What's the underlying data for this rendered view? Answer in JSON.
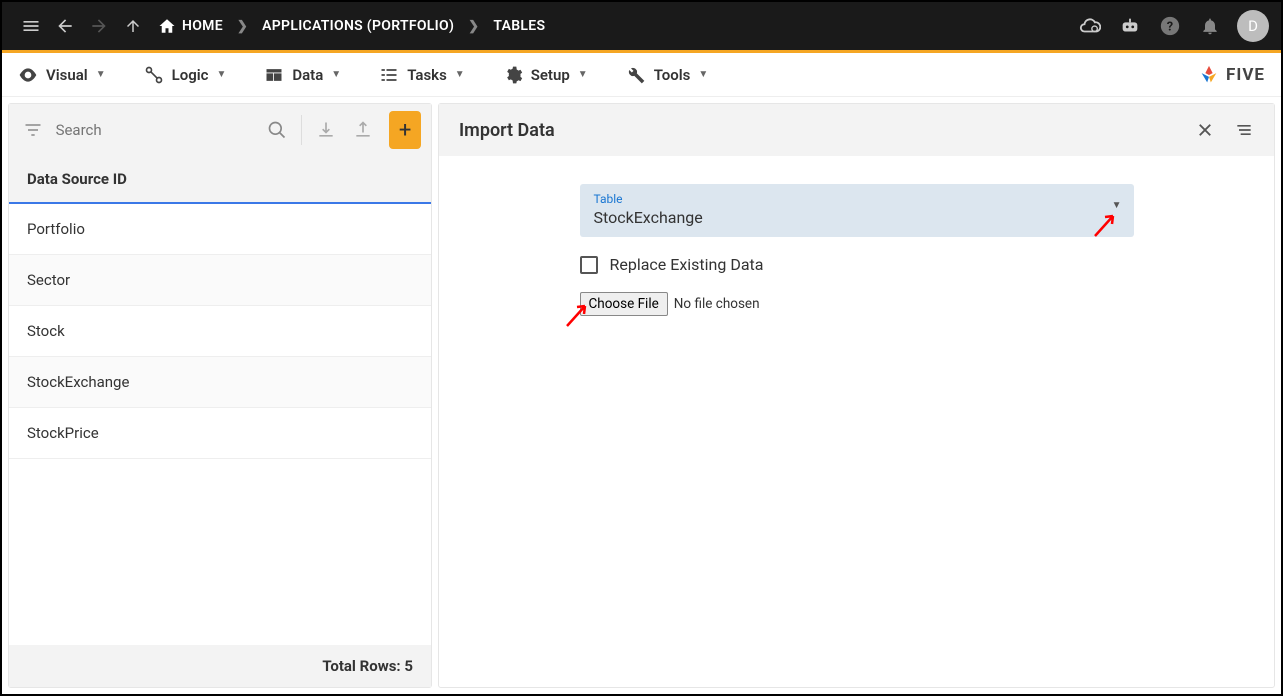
{
  "topbar": {
    "breadcrumb": [
      "HOME",
      "APPLICATIONS (PORTFOLIO)",
      "TABLES"
    ],
    "avatar": "D"
  },
  "menu": {
    "items": [
      "Visual",
      "Logic",
      "Data",
      "Tasks",
      "Setup",
      "Tools"
    ],
    "brand": "FIVE"
  },
  "left": {
    "search_placeholder": "Search",
    "column_header": "Data Source ID",
    "rows": [
      "Portfolio",
      "Sector",
      "Stock",
      "StockExchange",
      "StockPrice"
    ],
    "footer_label": "Total Rows:",
    "footer_count": "5"
  },
  "right": {
    "title": "Import Data",
    "table_label": "Table",
    "table_value": "StockExchange",
    "replace_label": "Replace Existing Data",
    "choose_file": "Choose File",
    "no_file": "No file chosen"
  }
}
